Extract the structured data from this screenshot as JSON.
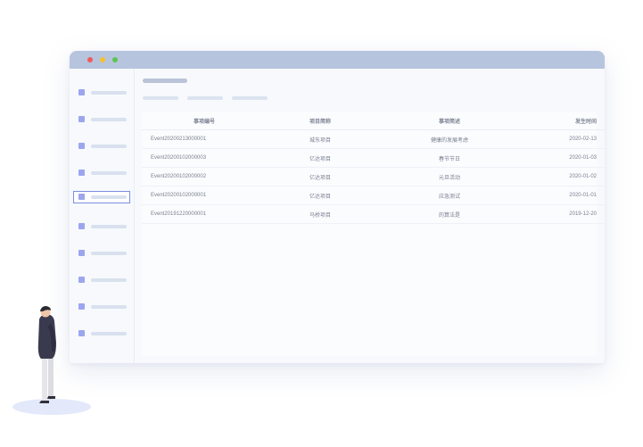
{
  "sidebar": {
    "item_count": 10,
    "active_index": 4
  },
  "table": {
    "headers": [
      "事项编号",
      "项目简称",
      "事项简述",
      "发生时间"
    ],
    "rows": [
      [
        "Event20200213000001",
        "城东项目",
        "健康的发展考虑",
        "2020-02-13"
      ],
      [
        "Event20200102000003",
        "亿达项目",
        "春节节日",
        "2020-01-03"
      ],
      [
        "Event20200102000002",
        "亿达项目",
        "元旦活动",
        "2020-01-02"
      ],
      [
        "Event20200102000001",
        "亿达项目",
        "应急测试",
        "2020-01-01"
      ],
      [
        "Event20191220000001",
        "马桥项目",
        "的算法是",
        "2019-12-20"
      ]
    ]
  },
  "colors": {
    "titlebar": "#b7c4de",
    "accent": "#9ca6ee",
    "close": "#f05a5a",
    "minimize": "#f4c030",
    "maximize": "#5cc64f"
  }
}
